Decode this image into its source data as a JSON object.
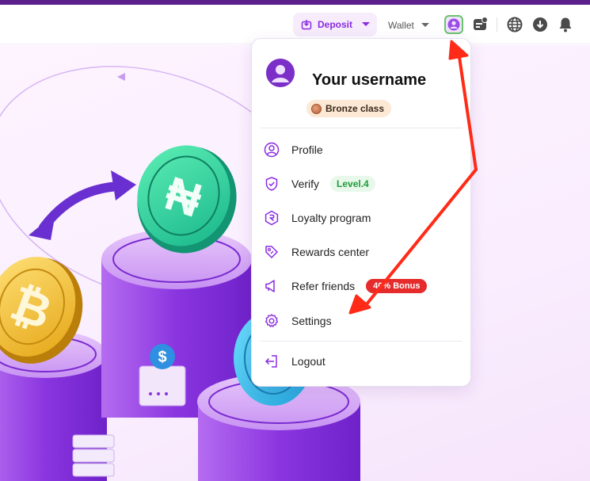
{
  "header": {
    "deposit_label": "Deposit",
    "wallet_label": "Wallet"
  },
  "menu": {
    "username": "Your username",
    "class_badge": "Bronze class",
    "items": [
      {
        "label": "Profile",
        "icon": "user-circle-icon"
      },
      {
        "label": "Verify",
        "icon": "shield-check-icon",
        "badge": "Level.4"
      },
      {
        "label": "Loyalty program",
        "icon": "loyalty-icon"
      },
      {
        "label": "Rewards center",
        "icon": "tag-icon"
      },
      {
        "label": "Refer friends",
        "icon": "megaphone-icon",
        "badge": "40% Bonus"
      },
      {
        "label": "Settings",
        "icon": "gear-icon"
      },
      {
        "label": "Logout",
        "icon": "logout-icon"
      }
    ]
  },
  "colors": {
    "brand": "#8a2be2",
    "top_strip": "#5a1f8a",
    "level_green": "#1f9a3b",
    "bonus_red": "#e52b2b",
    "annotation_red": "#ff2a17"
  }
}
